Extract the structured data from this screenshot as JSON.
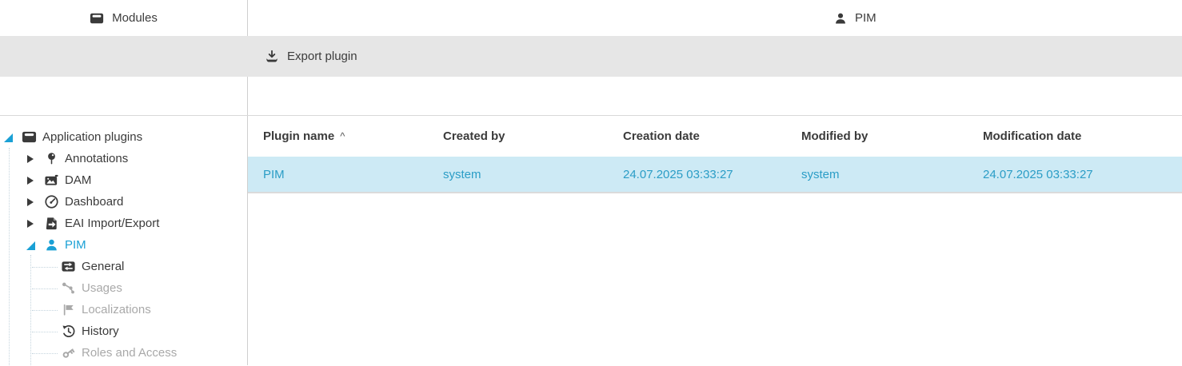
{
  "header": {
    "left_title": "Modules",
    "right_title": "PIM"
  },
  "toolbar": {
    "export_label": "Export plugin"
  },
  "tree": {
    "items": [
      {
        "label": "Application plugins",
        "level": 1,
        "expander": "expanded",
        "icon": "modules-box-icon",
        "state": "normal"
      },
      {
        "label": "Annotations",
        "level": 2,
        "expander": "collapsed",
        "icon": "pin-icon",
        "state": "normal"
      },
      {
        "label": "DAM",
        "level": 2,
        "expander": "collapsed",
        "icon": "image-icon",
        "state": "normal"
      },
      {
        "label": "Dashboard",
        "level": 2,
        "expander": "collapsed",
        "icon": "gauge-icon",
        "state": "normal"
      },
      {
        "label": "EAI Import/Export",
        "level": 2,
        "expander": "collapsed",
        "icon": "document-arrow-icon",
        "state": "normal"
      },
      {
        "label": "PIM",
        "level": 2,
        "expander": "expanded",
        "icon": "person-icon",
        "state": "selected"
      },
      {
        "label": "General",
        "level": 3,
        "expander": "none",
        "icon": "swap-icon",
        "state": "normal"
      },
      {
        "label": "Usages",
        "level": 3,
        "expander": "none",
        "icon": "share-icon",
        "state": "disabled"
      },
      {
        "label": "Localizations",
        "level": 3,
        "expander": "none",
        "icon": "flag-icon",
        "state": "disabled"
      },
      {
        "label": "History",
        "level": 3,
        "expander": "none",
        "icon": "history-icon",
        "state": "normal"
      },
      {
        "label": "Roles and Access",
        "level": 3,
        "expander": "none",
        "icon": "key-icon",
        "state": "disabled"
      }
    ]
  },
  "table": {
    "columns": [
      "Plugin name",
      "Created by",
      "Creation date",
      "Modified by",
      "Modification date"
    ],
    "column_keys": [
      "plugin_name",
      "created_by",
      "creation_date",
      "modified_by",
      "modification_date"
    ],
    "sort": {
      "column": "Plugin name",
      "glyph": "^"
    },
    "rows": [
      {
        "plugin_name": "PIM",
        "created_by": "system",
        "creation_date": "24.07.2025 03:33:27",
        "modified_by": "system",
        "modification_date": "24.07.2025 03:33:27"
      }
    ]
  },
  "icons": {
    "left_header": "modules-box-icon",
    "right_header": "person-icon",
    "export": "download-icon"
  },
  "colors": {
    "accent_blue": "#1aa0d5",
    "toolbar_bg": "#e6e6e6",
    "row_bg": "#cdeaf5",
    "row_text": "#2b9dc6",
    "disabled_text": "#a9a9a9"
  }
}
